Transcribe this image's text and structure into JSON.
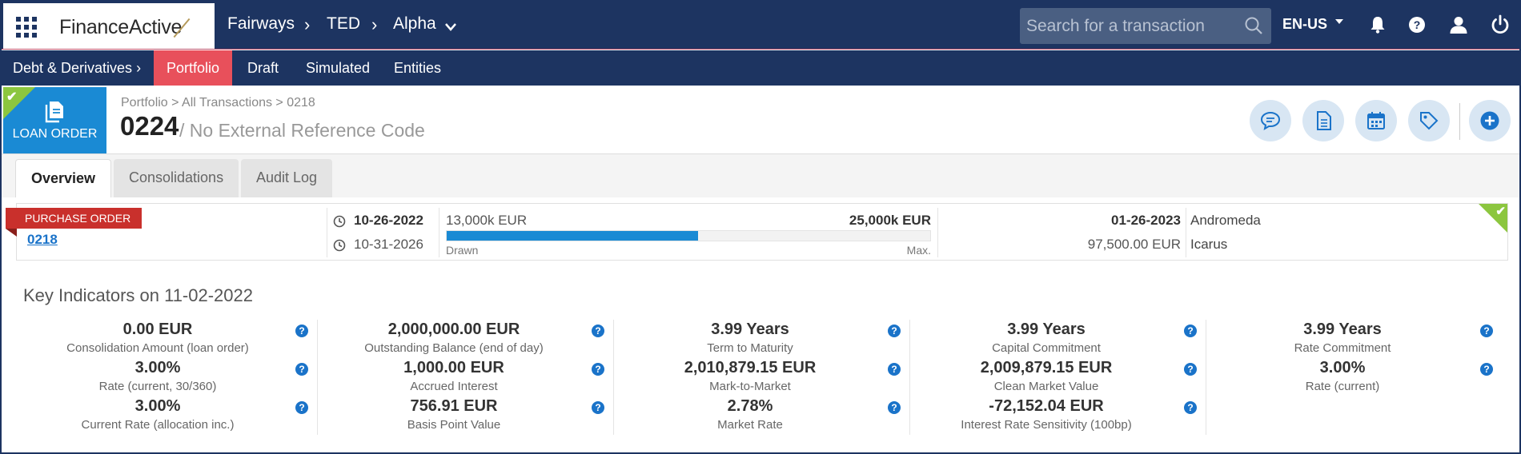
{
  "app": {
    "logo": "FinanceActive",
    "breadcrumb": [
      "Fairways",
      "TED",
      "Alpha"
    ],
    "search_placeholder": "Search for a transaction",
    "language": "EN-US",
    "icons": [
      "grid-icon",
      "search-icon",
      "bell-icon",
      "help-icon",
      "user-icon",
      "power-icon"
    ]
  },
  "nav": {
    "module": "Debt & Derivatives",
    "items": [
      {
        "label": "Portfolio",
        "active": true
      },
      {
        "label": "Draft",
        "active": false
      },
      {
        "label": "Simulated",
        "active": false
      },
      {
        "label": "Entities",
        "active": false
      }
    ],
    "active_color": "#e8505b",
    "bar_color": "#1d3461"
  },
  "header": {
    "type_label": "LOAN ORDER",
    "type_color": "#1a8ad4",
    "breadcrumb": "Portfolio > All Transactions >  0218",
    "title": "0224",
    "subtitle": "/ No External Reference Code",
    "action_icons": [
      "comment-icon",
      "document-icon",
      "calendar-icon",
      "tag-icon",
      "add-icon"
    ]
  },
  "tabs": [
    {
      "label": "Overview",
      "active": true
    },
    {
      "label": "Consolidations",
      "active": false
    },
    {
      "label": "Audit Log",
      "active": false
    }
  ],
  "summary": {
    "badge": "PURCHASE ORDER",
    "badge_color": "#c9302c",
    "link": "0218",
    "start_date": "10-26-2022",
    "end_date": "10-31-2026",
    "drawn_amount": "13,000k EUR",
    "max_amount": "25,000k EUR",
    "drawn_fraction": 0.52,
    "drawn_label": "Drawn",
    "max_label": "Max.",
    "right_date": "01-26-2023",
    "right_amount": "97,500.00 EUR",
    "name1": "Andromeda",
    "name2": "Icarus"
  },
  "key_indicators": {
    "title": "Key Indicators on 11-02-2022",
    "columns": [
      [
        {
          "value": "0.00 EUR",
          "label": "Consolidation Amount (loan order)"
        },
        {
          "value": "3.00%",
          "label": "Rate (current, 30/360)"
        },
        {
          "value": "3.00%",
          "label": "Current Rate (allocation inc.)"
        }
      ],
      [
        {
          "value": "2,000,000.00 EUR",
          "label": "Outstanding Balance (end of day)"
        },
        {
          "value": "1,000.00 EUR",
          "label": "Accrued Interest"
        },
        {
          "value": "756.91 EUR",
          "label": "Basis Point Value"
        }
      ],
      [
        {
          "value": "3.99 Years",
          "label": "Term to Maturity"
        },
        {
          "value": "2,010,879.15 EUR",
          "label": "Mark-to-Market"
        },
        {
          "value": "2.78%",
          "label": "Market Rate"
        }
      ],
      [
        {
          "value": "3.99 Years",
          "label": "Capital Commitment"
        },
        {
          "value": "2,009,879.15 EUR",
          "label": "Clean Market Value"
        },
        {
          "value": "-72,152.04 EUR",
          "label": "Interest Rate Sensitivity (100bp)"
        }
      ],
      [
        {
          "value": "3.99 Years",
          "label": "Rate Commitment"
        },
        {
          "value": "3.00%",
          "label": "Rate (current)"
        }
      ]
    ],
    "help_glyph": "?"
  }
}
